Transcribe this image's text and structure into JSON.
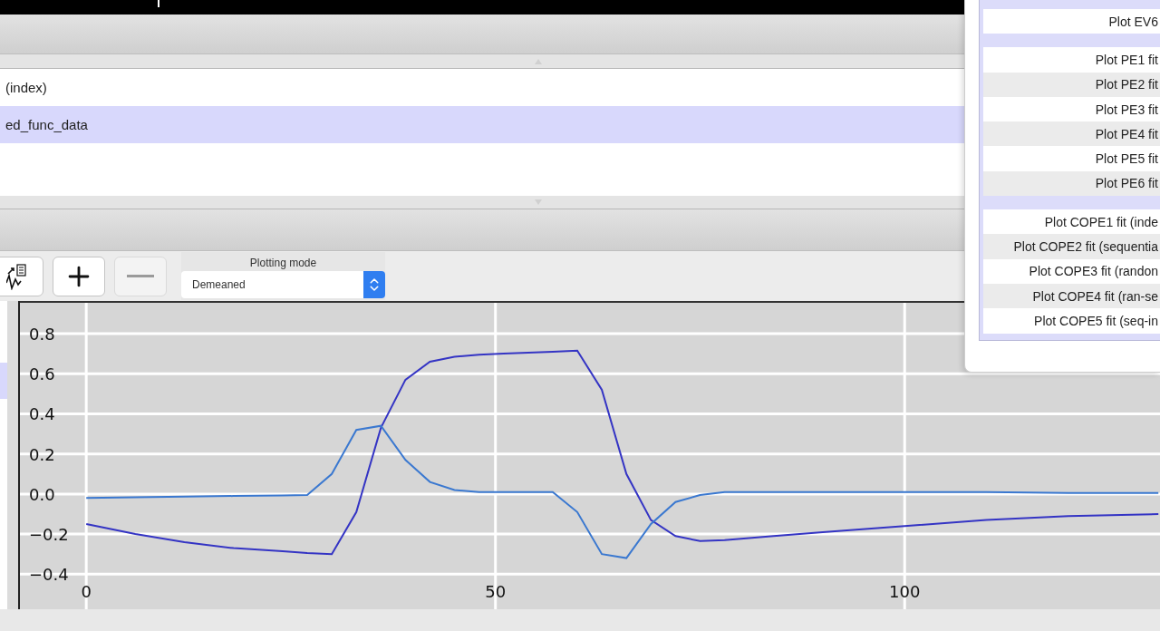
{
  "list": {
    "rows": [
      {
        "text": "(index)",
        "selected": false
      },
      {
        "text": "ed_func_data",
        "selected": true
      }
    ]
  },
  "toolbar": {
    "buttons": [
      {
        "kind": "plot-icon",
        "disabled": false
      },
      {
        "kind": "add",
        "disabled": false
      },
      {
        "kind": "remove",
        "disabled": true
      }
    ],
    "plotting_mode": {
      "label": "Plotting mode",
      "value": "Demeaned"
    }
  },
  "plot": {
    "chart_data": {
      "type": "line",
      "x": [
        0,
        6,
        12,
        18,
        24,
        27,
        30,
        33,
        36,
        39,
        42,
        45,
        48,
        51,
        54,
        57,
        60,
        63,
        66,
        69,
        72,
        75,
        78,
        84,
        90,
        100,
        110,
        120,
        131
      ],
      "series": [
        {
          "color": "#3434c4",
          "values": [
            -0.15,
            -0.2,
            -0.24,
            -0.27,
            -0.285,
            -0.295,
            -0.3,
            -0.09,
            0.33,
            0.57,
            0.66,
            0.685,
            0.695,
            0.7,
            0.705,
            0.71,
            0.715,
            0.52,
            0.1,
            -0.13,
            -0.21,
            -0.235,
            -0.23,
            -0.21,
            -0.19,
            -0.16,
            -0.13,
            -0.11,
            -0.1
          ]
        },
        {
          "color": "#3a78d0",
          "values": [
            -0.02,
            -0.017,
            -0.013,
            -0.01,
            -0.007,
            -0.005,
            0.1,
            0.32,
            0.34,
            0.17,
            0.06,
            0.02,
            0.01,
            0.01,
            0.01,
            0.01,
            -0.09,
            -0.3,
            -0.32,
            -0.15,
            -0.04,
            -0.005,
            0.01,
            0.01,
            0.01,
            0.01,
            0.01,
            0.005,
            0.005
          ]
        }
      ],
      "grid": true,
      "xlim": [
        -8.1,
        131.2
      ],
      "ylim": [
        -0.575,
        0.954
      ],
      "xticks": [
        0,
        50,
        100
      ],
      "yticks": [
        {
          "value": -0.4,
          "label": "−0.4"
        },
        {
          "value": -0.2,
          "label": "−0.2"
        },
        {
          "value": 0,
          "label": "0.0"
        },
        {
          "value": 0.2,
          "label": "0.2"
        },
        {
          "value": 0.4,
          "label": "0.4"
        },
        {
          "value": 0.6,
          "label": "0.6"
        },
        {
          "value": 0.8,
          "label": "0.8"
        }
      ]
    }
  },
  "popup": {
    "groups": [
      {
        "items": [
          "Plot EV6"
        ]
      },
      {
        "items": [
          "Plot PE1 fit",
          "Plot PE2 fit",
          "Plot PE3 fit",
          "Plot PE4 fit",
          "Plot PE5 fit",
          "Plot PE6 fit"
        ]
      },
      {
        "items": [
          "Plot COPE1 fit (inde",
          "Plot COPE2 fit (sequentia",
          "Plot COPE3 fit (randon",
          "Plot COPE4 fit (ran-se",
          "Plot COPE5 fit (seq-in"
        ]
      }
    ]
  }
}
